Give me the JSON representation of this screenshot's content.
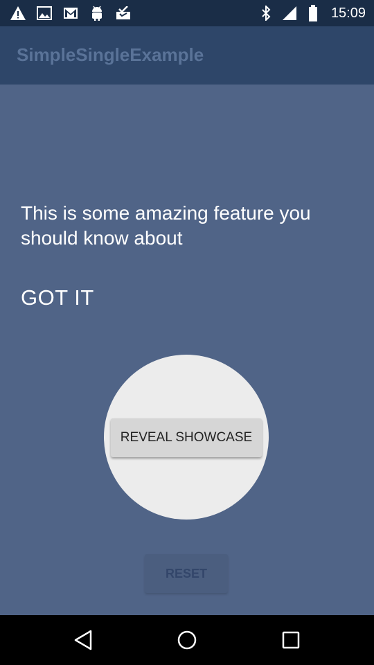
{
  "status_bar": {
    "time": "15:09",
    "left_icons": [
      "warning-icon",
      "image-icon",
      "gmail-icon",
      "android-icon",
      "inbox-check-icon"
    ],
    "right_icons": [
      "bluetooth-icon",
      "signal-icon",
      "battery-icon"
    ]
  },
  "app_bar": {
    "title": "SimpleSingleExample"
  },
  "showcase": {
    "text": "This is some amazing feature you should know about",
    "dismiss_label": "GOT IT"
  },
  "main": {
    "reveal_label": "REVEAL SHOWCASE",
    "reset_label": "RESET"
  },
  "nav_bar": {
    "icons": [
      "back-icon",
      "home-icon",
      "recents-icon"
    ]
  },
  "colors": {
    "status_bar": "#1a2d47",
    "app_bar": "#2e4669",
    "overlay": "#506487",
    "highlight": "#ececec"
  }
}
